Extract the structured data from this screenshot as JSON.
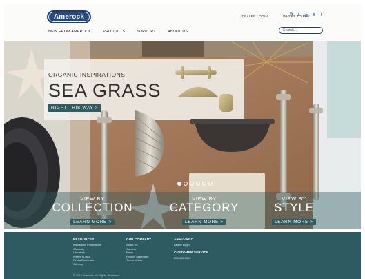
{
  "brand": {
    "logo_text": "Amerock"
  },
  "utility_nav": {
    "dealer_login": "DEALER LOGIN",
    "where_to_buy": "WHERE TO BUY"
  },
  "social": [
    {
      "icon": "pinterest-icon",
      "glyph": "P"
    },
    {
      "icon": "facebook-icon",
      "glyph": "f"
    },
    {
      "icon": "instagram-icon",
      "glyph": "◎"
    },
    {
      "icon": "houzz-icon",
      "glyph": "h"
    },
    {
      "icon": "twitter-icon",
      "glyph": "t"
    }
  ],
  "main_nav": [
    {
      "label": "NEW FROM AMEROCK"
    },
    {
      "label": "PRODUCTS"
    },
    {
      "label": "SUPPORT"
    },
    {
      "label": "ABOUT US"
    }
  ],
  "search": {
    "placeholder": "Search..."
  },
  "hero": {
    "eyebrow": "ORGANIC INSPIRATIONS",
    "title": "SEA GRASS",
    "cta": "RIGHT THIS WAY >",
    "slides": [
      true,
      false,
      false,
      false,
      false,
      false
    ]
  },
  "tiles": [
    {
      "small": "VIEW BY",
      "big": "COLLECTION",
      "button": "LEARN MORE >"
    },
    {
      "small": "VIEW BY",
      "big": "CATEGORY",
      "button": "LEARN MORE >"
    },
    {
      "small": "VIEW BY",
      "big": "STYLE",
      "button": "LEARN MORE >"
    }
  ],
  "footer": {
    "resources": {
      "heading": "RESOURCES",
      "links": [
        "Installation Instructions",
        "Warranty",
        "Literature",
        "Where to Buy",
        "Find a Distributor",
        "Sitemap"
      ]
    },
    "company": {
      "heading": "OUR COMPANY",
      "links": [
        "About Us",
        "Careers",
        "Press",
        "Privacy Statement",
        "Terms of Use"
      ]
    },
    "go": {
      "heading": "AmerockGO",
      "links": [
        "Dealer Login"
      ]
    },
    "service": {
      "heading": "CUSTOMER SERVICE",
      "links": [
        "800.435.6959"
      ]
    },
    "copyright": "© 2015 Amerock. All Rights Reserved."
  },
  "colors": {
    "brand_blue": "#234a8c",
    "teal": "#2e5b61"
  }
}
